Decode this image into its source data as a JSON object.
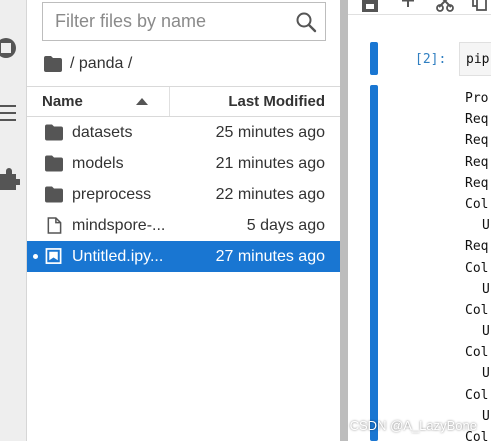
{
  "filter": {
    "placeholder": "Filter files by name"
  },
  "breadcrumb": {
    "path": "/ panda /"
  },
  "columns": {
    "name": "Name",
    "last_modified": "Last Modified"
  },
  "files": [
    {
      "name": "datasets",
      "modified": "25 minutes ago",
      "icon": "folder-icon"
    },
    {
      "name": "models",
      "modified": "21 minutes ago",
      "icon": "folder-icon"
    },
    {
      "name": "preprocess",
      "modified": "22 minutes ago",
      "icon": "folder-icon"
    },
    {
      "name": "mindspore-...",
      "modified": "5 days ago",
      "icon": "file-icon"
    },
    {
      "name": "Untitled.ipy...",
      "modified": "27 minutes ago",
      "icon": "notebook-icon",
      "selected": true
    }
  ],
  "notebook": {
    "prompt": "[2]:",
    "code": "pip",
    "output_lines": [
      "Pro",
      "Req",
      "Req",
      "Req",
      "Req",
      "Col",
      "U",
      "Req",
      "Col",
      "U",
      "Col",
      "U",
      "Col",
      "U",
      "Col",
      "U",
      "Col"
    ]
  },
  "watermark": "CSDN @A_LazyBone",
  "colors": {
    "selection": "#1976d2",
    "prompt": "#307fc1",
    "splitter": "#bdbdbd"
  }
}
